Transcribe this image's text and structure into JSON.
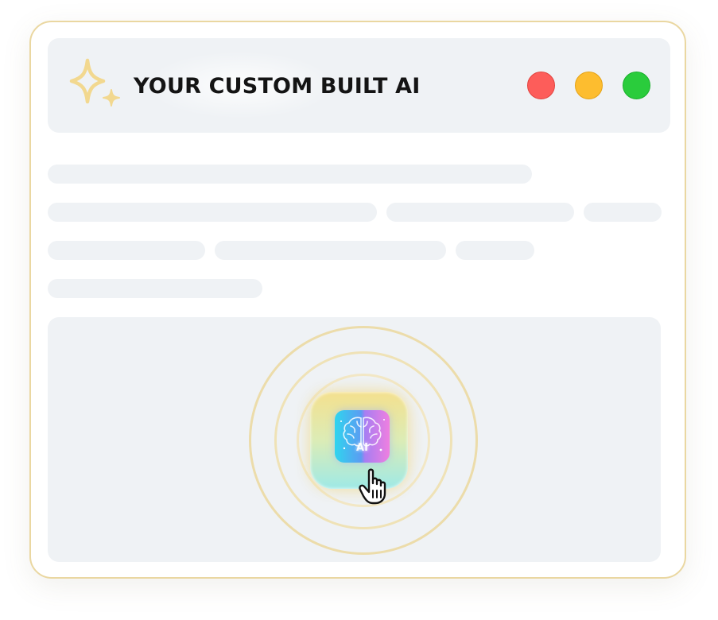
{
  "window": {
    "title": "YOUR CUSTOM BUILT AI",
    "title_icon": "sparkle-icon",
    "controls": [
      {
        "name": "close",
        "color": "#fd5d5a"
      },
      {
        "name": "minimize",
        "color": "#fdbd2f"
      },
      {
        "name": "maximize",
        "color": "#2acc3c"
      }
    ]
  },
  "content": {
    "placeholder_lines": 4,
    "ai_button": {
      "label": "AI",
      "icon": "brain-ai-icon",
      "cursor": "hand-pointer-icon"
    }
  },
  "colors": {
    "border": "#ead7a1",
    "surface": "#eff2f5",
    "ring": "#ecdcaa"
  }
}
